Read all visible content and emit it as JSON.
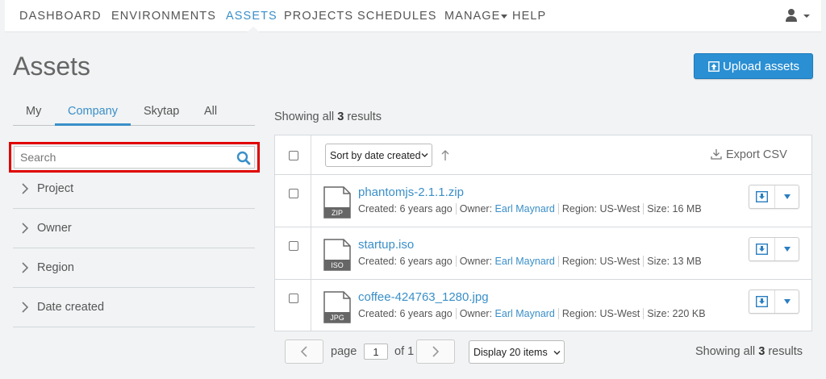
{
  "nav": {
    "items": [
      "DASHBOARD",
      "ENVIRONMENTS",
      "ASSETS",
      "PROJECTS",
      "SCHEDULES",
      "MANAGE",
      "HELP"
    ],
    "active": "ASSETS",
    "user_icon": "user-icon"
  },
  "page": {
    "title": "Assets"
  },
  "tabs": {
    "items": [
      "My",
      "Company",
      "Skytap",
      "All"
    ],
    "active": "Company"
  },
  "search": {
    "placeholder": "Search",
    "value": ""
  },
  "filters": [
    "Project",
    "Owner",
    "Region",
    "Date created"
  ],
  "upload": {
    "label": "Upload assets"
  },
  "results": {
    "prefix": "Showing all",
    "count": "3",
    "suffix": "results"
  },
  "toolbar": {
    "sort_label": "Sort by date created",
    "export_label": "Export CSV"
  },
  "assets": [
    {
      "name": "phantomjs-2.1.1.zip",
      "type": "ZIP",
      "created_label": "Created:",
      "created": "6 years ago",
      "owner_label": "Owner:",
      "owner": "Earl Maynard",
      "region_label": "Region:",
      "region": "US-West",
      "size_label": "Size:",
      "size": "16 MB"
    },
    {
      "name": "startup.iso",
      "type": "ISO",
      "created_label": "Created:",
      "created": "6 years ago",
      "owner_label": "Owner:",
      "owner": "Earl Maynard",
      "region_label": "Region:",
      "region": "US-West",
      "size_label": "Size:",
      "size": "13 MB"
    },
    {
      "name": "coffee-424763_1280.jpg",
      "type": "JPG",
      "created_label": "Created:",
      "created": "6 years ago",
      "owner_label": "Owner:",
      "owner": "Earl Maynard",
      "region_label": "Region:",
      "region": "US-West",
      "size_label": "Size:",
      "size": "220 KB"
    }
  ],
  "pagination": {
    "page_label": "page",
    "current": "1",
    "of_label": "of 1",
    "display_label": "Display 20 items"
  },
  "colors": {
    "accent": "#3a8fc8",
    "primary_button": "#2a8fd3",
    "highlight": "#e00000"
  }
}
